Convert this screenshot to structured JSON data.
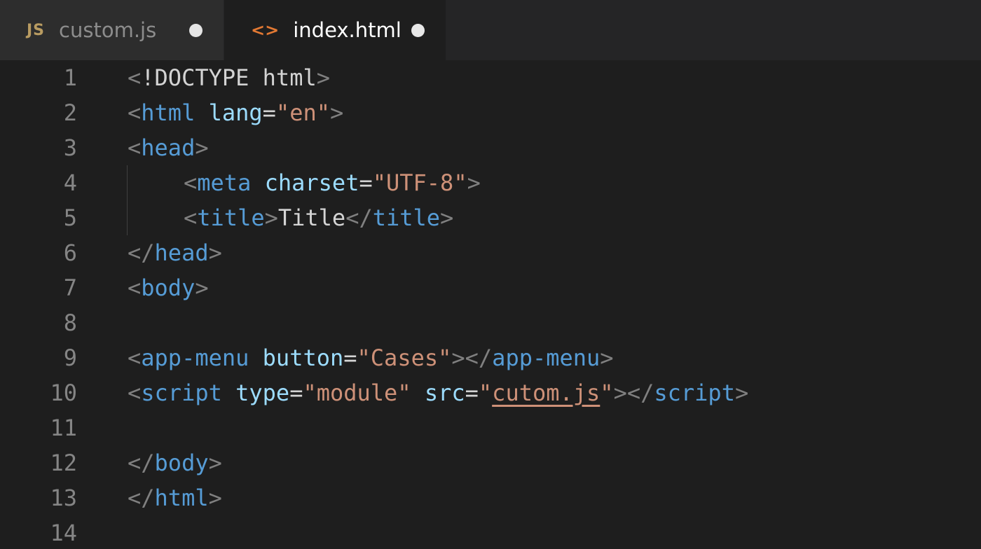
{
  "tabs": [
    {
      "icon": "JS",
      "label": "custom.js",
      "state": "inactive"
    },
    {
      "icon": "<>",
      "label": "index.html",
      "state": "active"
    }
  ],
  "colors": {
    "editor_bg": "#1e1e1e",
    "tag": "#569cd6",
    "attribute": "#9cdcfe",
    "string": "#ce9178",
    "punctuation": "#808080",
    "line_number": "#858585"
  },
  "editor": {
    "line_numbers": [
      "1",
      "2",
      "3",
      "4",
      "5",
      "6",
      "7",
      "8",
      "9",
      "10",
      "11",
      "12",
      "13",
      "14"
    ],
    "tokens": {
      "l1_open": "<",
      "l1_doctype": "!DOCTYPE html",
      "l1_close": ">",
      "l2_open": "<",
      "l2_tag": "html",
      "l2_attr": "lang",
      "l2_eq": "=",
      "l2_val": "\"en\"",
      "l2_close": ">",
      "l3_open": "<",
      "l3_tag": "head",
      "l3_close": ">",
      "l4_open": "<",
      "l4_tag": "meta",
      "l4_attr": "charset",
      "l4_eq": "=",
      "l4_val": "\"UTF-8\"",
      "l4_close": ">",
      "l5_open": "<",
      "l5_tag": "title",
      "l5_close": ">",
      "l5_text": "Title",
      "l5_end_open": "</",
      "l5_end_tag": "title",
      "l5_end_close": ">",
      "l6_open": "</",
      "l6_tag": "head",
      "l6_close": ">",
      "l7_open": "<",
      "l7_tag": "body",
      "l7_close": ">",
      "l9_open": "<",
      "l9_tag": "app-menu",
      "l9_attr": "button",
      "l9_eq": "=",
      "l9_val": "\"Cases\"",
      "l9_close": ">",
      "l9_end_open": "</",
      "l9_end_tag": "app-menu",
      "l9_end_close": ">",
      "l10_open": "<",
      "l10_tag": "script",
      "l10_attr1": "type",
      "l10_eq1": "=",
      "l10_val1": "\"module\"",
      "l10_attr2": "src",
      "l10_eq2": "=",
      "l10_q1": "\"",
      "l10_link": "cutom.js",
      "l10_q2": "\"",
      "l10_close": ">",
      "l10_end_open": "</",
      "l10_end_tag": "script",
      "l10_end_close": ">",
      "l12_open": "</",
      "l12_tag": "body",
      "l12_close": ">",
      "l13_open": "</",
      "l13_tag": "html",
      "l13_close": ">"
    }
  }
}
